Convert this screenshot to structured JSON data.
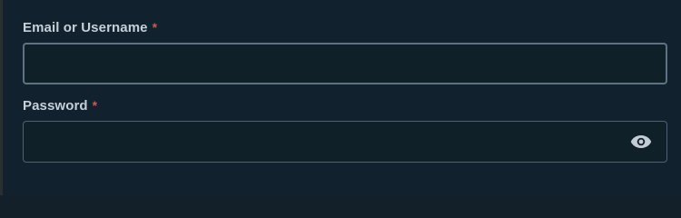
{
  "form": {
    "email": {
      "label": "Email or Username",
      "required_marker": "*",
      "value": "",
      "placeholder": ""
    },
    "password": {
      "label": "Password",
      "required_marker": "*",
      "value": "",
      "placeholder": "",
      "toggle_icon": "eye-icon"
    }
  },
  "colors": {
    "background": "#11212d",
    "label": "#c6d0d8",
    "required": "#d9534f",
    "input_border": "#5e7381",
    "icon": "#c3ccd4"
  }
}
